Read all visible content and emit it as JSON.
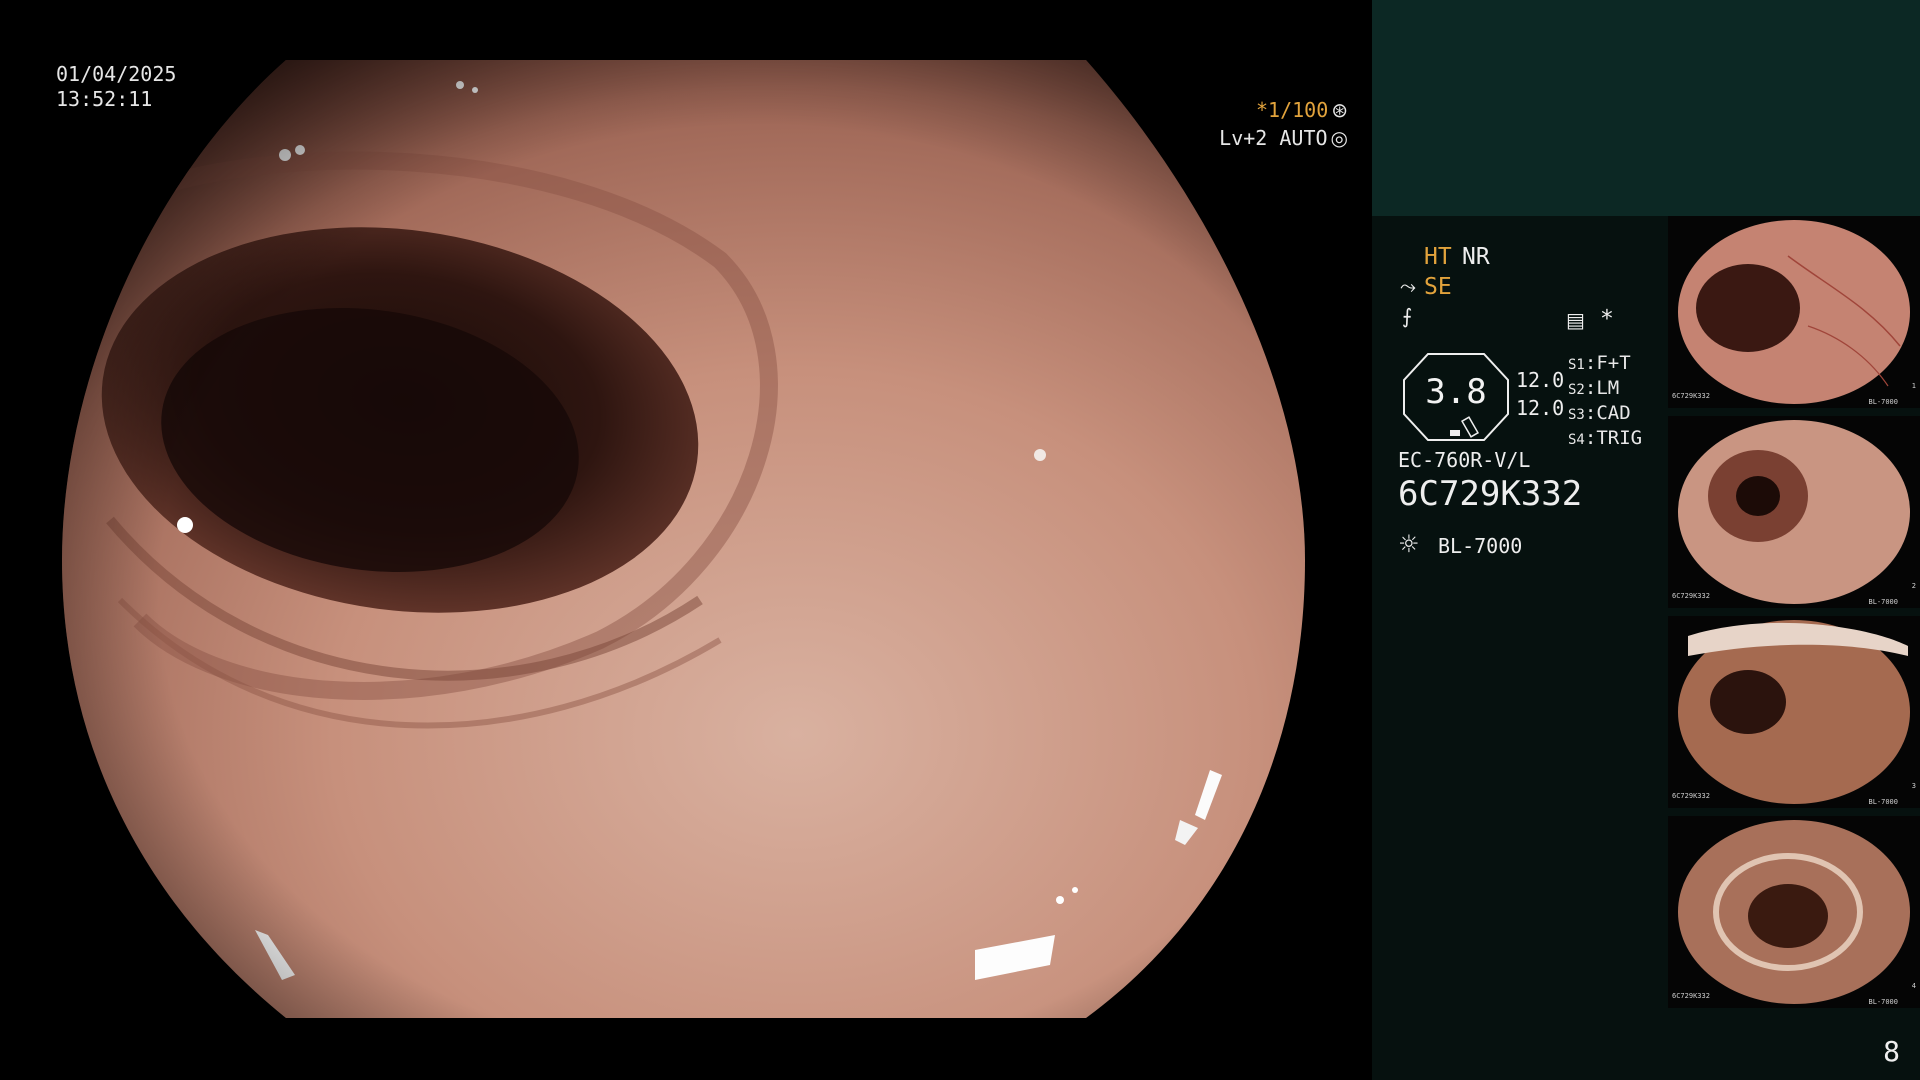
{
  "overlay": {
    "date": "01/04/2025",
    "time": "13:52:11",
    "shutter": "*1/100",
    "shutter_icon": "aperture-icon",
    "level": "Lv+2 AUTO",
    "level_icon": "iris-icon"
  },
  "status": {
    "ht": "HT",
    "nr": "NR",
    "se": "SE",
    "enhance_icon": "structure-enhance-icon",
    "freeze_icon": "freeze-icon",
    "menu_icon": "settings-panel-icon",
    "asterisk": "*",
    "gauge_value": "3.8",
    "side_values": [
      "12.0",
      "12.0"
    ],
    "switches": [
      {
        "key": "S1",
        "value": "F+T"
      },
      {
        "key": "S2",
        "value": "LM"
      },
      {
        "key": "S3",
        "value": "CAD"
      },
      {
        "key": "S4",
        "value": "TRIG"
      }
    ],
    "scope_model": "EC-760R-V/L",
    "serial": "6C729K332",
    "light_icon": "light-source-icon",
    "light_source": "BL-7000"
  },
  "thumbnails": [
    {
      "label": "6C729K332",
      "bottom": "BL-7000",
      "num": "1"
    },
    {
      "label": "6C729K332",
      "bottom": "BL-7000",
      "num": "2"
    },
    {
      "label": "6C729K332",
      "bottom": "BL-7000",
      "num": "3"
    },
    {
      "label": "6C729K332",
      "bottom": "BL-7000",
      "num": "4"
    }
  ],
  "page_number": "8",
  "colors": {
    "sidebar_top": "#0c2824",
    "sidebar": "#06110f",
    "accent": "#e2a33c"
  }
}
